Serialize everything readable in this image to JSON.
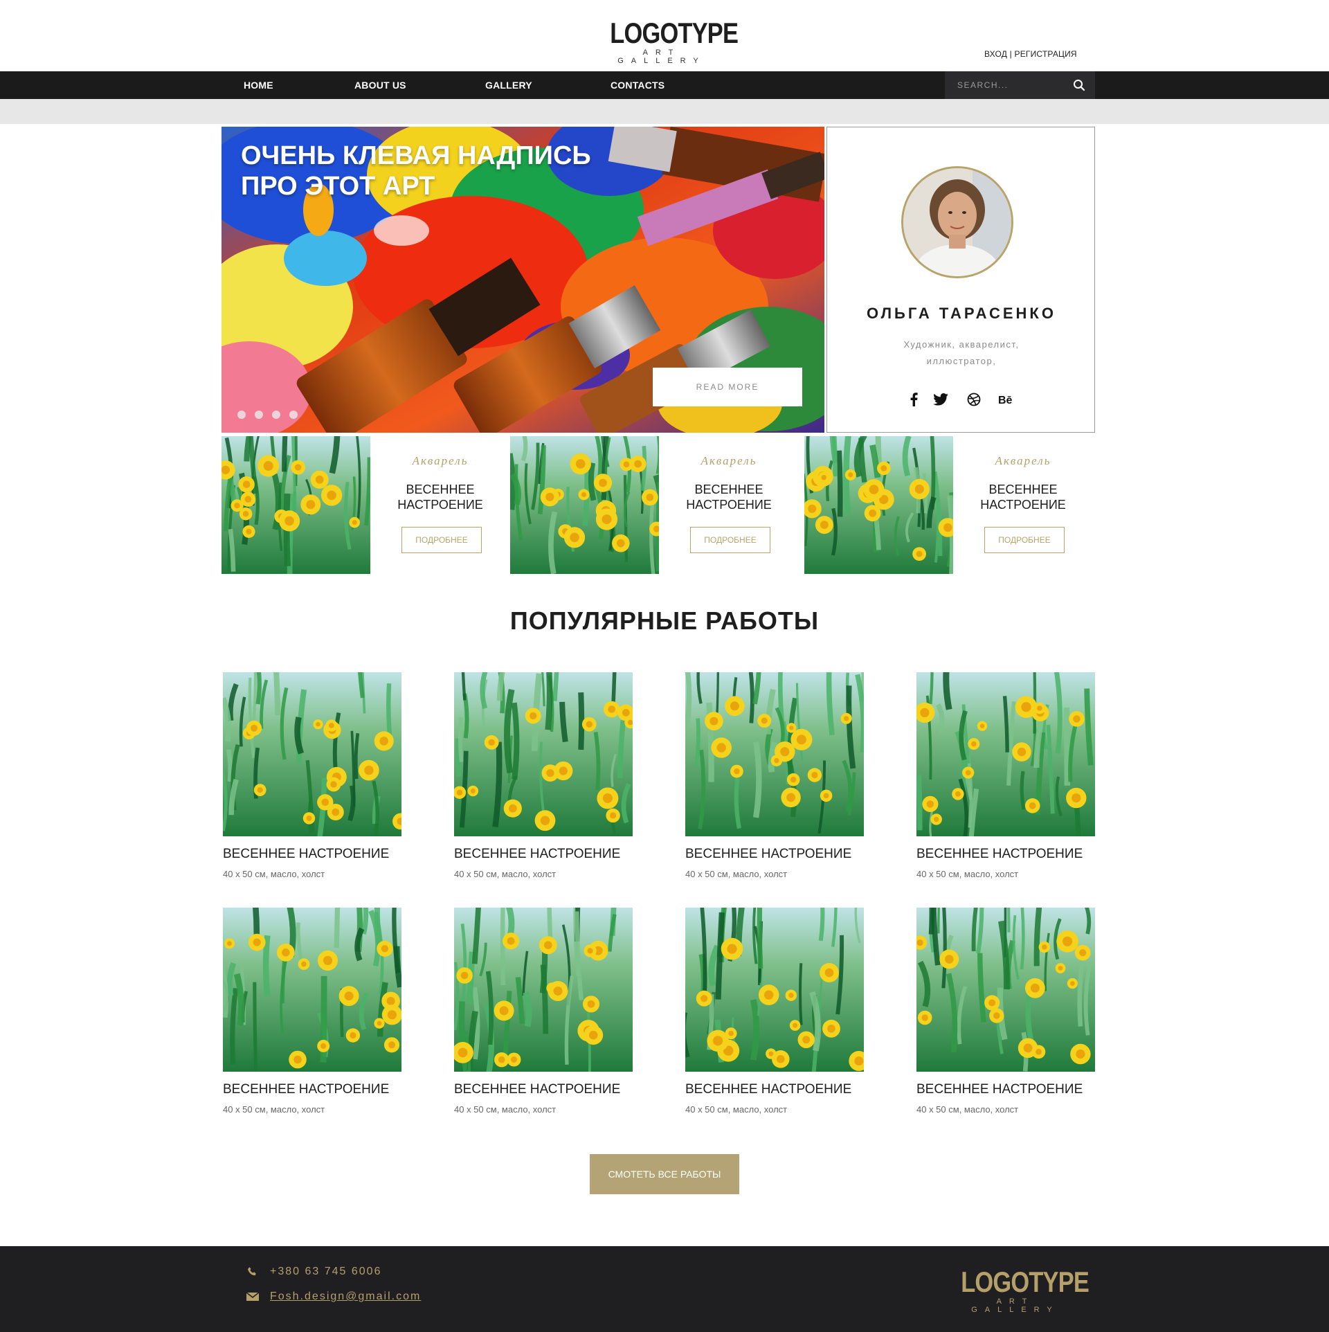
{
  "header": {
    "logo_main": "LOGOTYPE",
    "logo_sub": "ART GALLERY",
    "auth_login": "ВХОД",
    "auth_sep": " | ",
    "auth_register": "РЕГИСТРАЦИЯ"
  },
  "nav": {
    "items": [
      {
        "label": "HOME"
      },
      {
        "label": "ABOUT US"
      },
      {
        "label": "GALLERY"
      },
      {
        "label": "CONTACTS"
      }
    ],
    "search_placeholder": "SEARCH..."
  },
  "hero": {
    "title_line1": "ОЧЕНЬ КЛЕВАЯ НАДПИСЬ",
    "title_line2": "ПРО ЭТОТ АРТ",
    "read_more": "READ MORE",
    "slides_count": 4
  },
  "profile": {
    "name": "ОЛЬГА ТАРАСЕНКО",
    "role_line1": "Художник, акварелист,",
    "role_line2": "иллюстратор,",
    "socials": [
      "facebook-icon",
      "twitter-icon",
      "dribbble-icon",
      "behance-icon"
    ]
  },
  "featured": [
    {
      "category": "Акварель",
      "title_line1": "ВЕСЕННЕЕ",
      "title_line2": "НАСТРОЕНИЕ",
      "button": "ПОДРОБНЕЕ"
    },
    {
      "category": "Акварель",
      "title_line1": "ВЕСЕННЕЕ",
      "title_line2": "НАСТРОЕНИЕ",
      "button": "ПОДРОБНЕЕ"
    },
    {
      "category": "Акварель",
      "title_line1": "ВЕСЕННЕЕ",
      "title_line2": "НАСТРОЕНИЕ",
      "button": "ПОДРОБНЕЕ"
    }
  ],
  "popular": {
    "title": "ПОПУЛЯРНЫЕ РАБОТЫ",
    "items": [
      {
        "title": "ВЕСЕННЕЕ НАСТРОЕНИЕ",
        "desc": "40 х 50 см, масло, холст"
      },
      {
        "title": "ВЕСЕННЕЕ НАСТРОЕНИЕ",
        "desc": "40 х 50 см, масло, холст"
      },
      {
        "title": "ВЕСЕННЕЕ НАСТРОЕНИЕ",
        "desc": "40 х 50 см, масло, холст"
      },
      {
        "title": "ВЕСЕННЕЕ НАСТРОЕНИЕ",
        "desc": "40 х 50 см, масло, холст"
      },
      {
        "title": "ВЕСЕННЕЕ НАСТРОЕНИЕ",
        "desc": "40 х 50 см, масло, холст"
      },
      {
        "title": "ВЕСЕННЕЕ НАСТРОЕНИЕ",
        "desc": "40 х 50 см, масло, холст"
      },
      {
        "title": "ВЕСЕННЕЕ НАСТРОЕНИЕ",
        "desc": "40 х 50 см, масло, холст"
      },
      {
        "title": "ВЕСЕННЕЕ НАСТРОЕНИЕ",
        "desc": "40 х 50 см, масло, холст"
      }
    ],
    "view_all": "СМОТЕТЬ ВСЕ РАБОТЫ"
  },
  "footer": {
    "phone": "+380 63 745 6006",
    "email": "Fosh.design@gmail.com",
    "logo_main": "LOGOTYPE",
    "logo_sub": "ART GALLERY"
  },
  "colors": {
    "gold": "#b5a06a",
    "nav_bg": "#1b1b1b",
    "footer_bg": "#1f1f22"
  }
}
